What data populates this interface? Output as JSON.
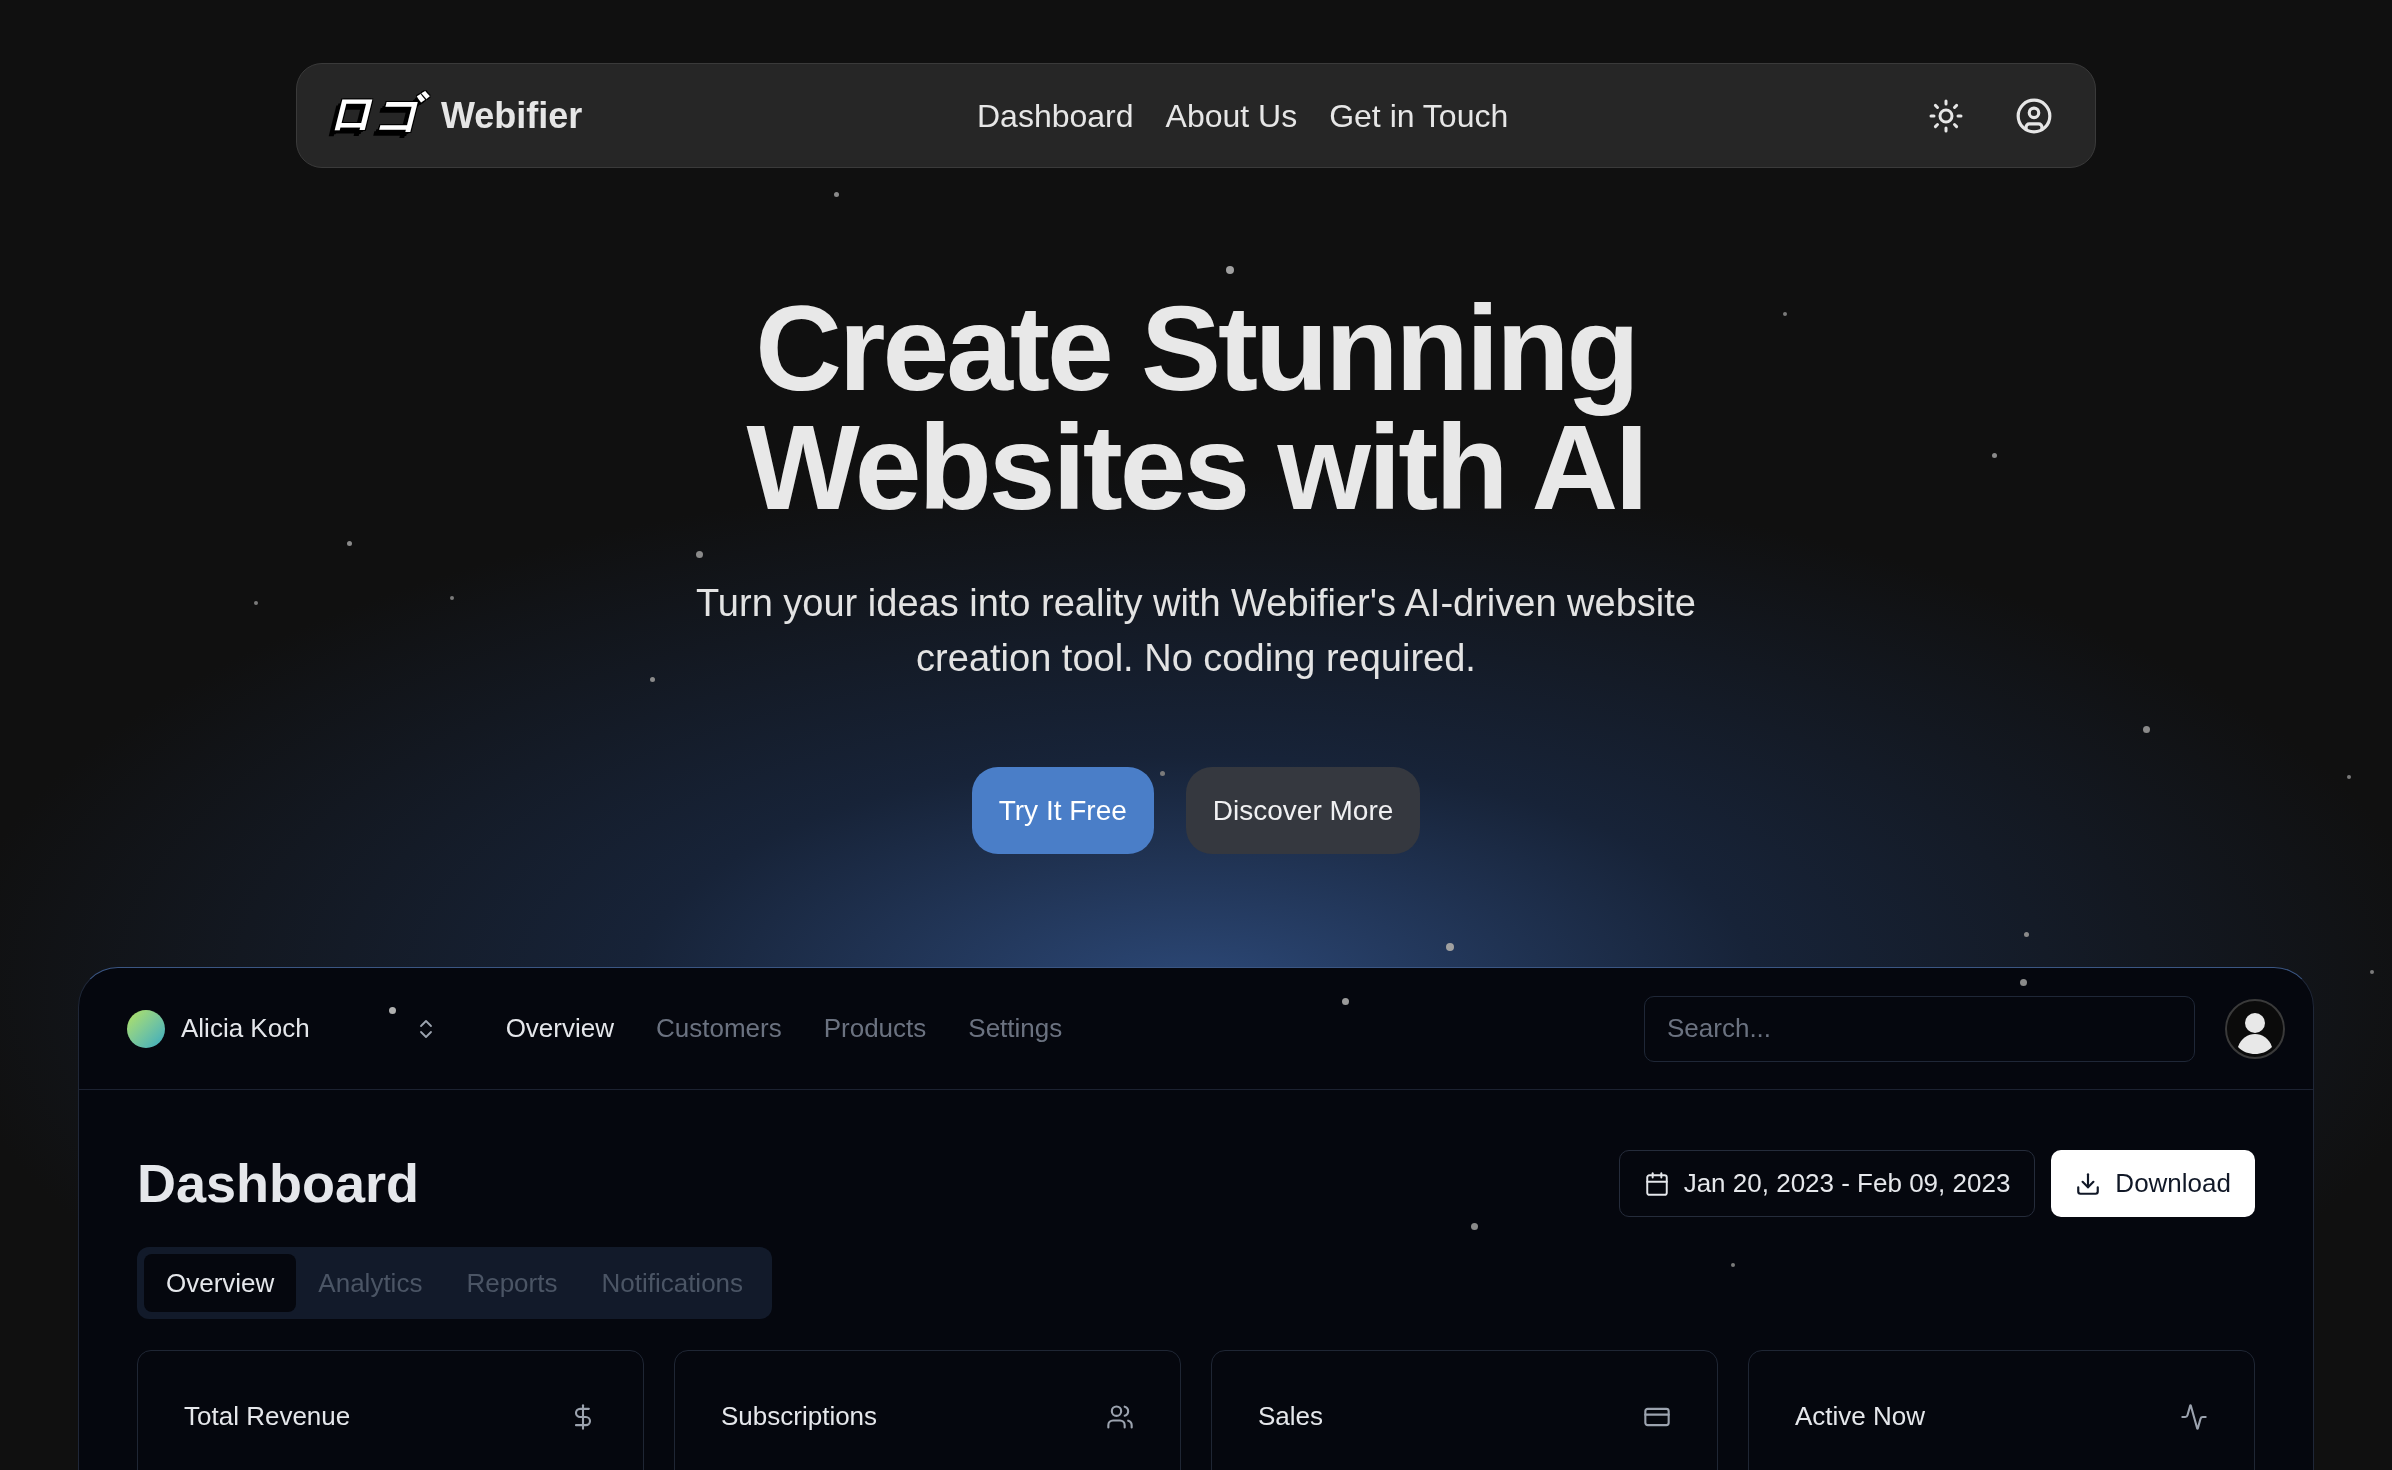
{
  "navbar": {
    "logo_text": "ロゴ",
    "brand": "Webifier",
    "links": [
      "Dashboard",
      "About Us",
      "Get in Touch"
    ]
  },
  "hero": {
    "title": "Create Stunning Websites with AI",
    "subtitle": "Turn your ideas into reality with Webifier's AI-driven website creation tool. No coding required.",
    "buttons": [
      {
        "label": "Try It Free",
        "kind": "primary"
      },
      {
        "label": "Discover More",
        "kind": "secondary"
      }
    ]
  },
  "dashboard_preview": {
    "account": {
      "name": "Alicia Koch"
    },
    "nav": [
      {
        "label": "Overview",
        "selected": true
      },
      {
        "label": "Customers",
        "selected": false
      },
      {
        "label": "Products",
        "selected": false
      },
      {
        "label": "Settings",
        "selected": false
      }
    ],
    "search": {
      "placeholder": "Search..."
    },
    "title": "Dashboard",
    "date_range": "Jan 20, 2023 - Feb 09, 2023",
    "download_label": "Download",
    "tabs": [
      {
        "label": "Overview",
        "selected": true
      },
      {
        "label": "Analytics",
        "selected": false
      },
      {
        "label": "Reports",
        "selected": false
      },
      {
        "label": "Notifications",
        "selected": false
      }
    ],
    "cards": [
      {
        "title": "Total Revenue"
      },
      {
        "title": "Subscriptions"
      },
      {
        "title": "Sales"
      },
      {
        "title": "Active Now"
      }
    ]
  }
}
